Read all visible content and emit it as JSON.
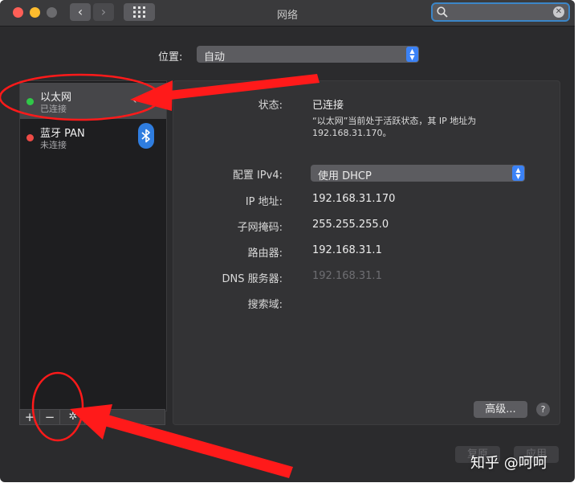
{
  "window": {
    "title": "网络"
  },
  "toolbar": {
    "back_glyph": "‹",
    "forward_glyph": "›"
  },
  "search": {
    "placeholder": ""
  },
  "location": {
    "label": "位置:",
    "value": "自动"
  },
  "services": [
    {
      "name": "以太网",
      "status": "已连接",
      "status_color": "#30c848",
      "icon": "ethernet-icon"
    },
    {
      "name": "蓝牙 PAN",
      "status": "未连接",
      "status_color": "#ee4b46",
      "icon": "bluetooth-icon"
    }
  ],
  "sidebar_toolbar": {
    "add": "+",
    "remove": "−",
    "gear": "✲"
  },
  "detail": {
    "status_label": "状态:",
    "status_value": "已连接",
    "status_desc": "“以太网”当前处于活跃状态，其 IP 地址为 192.168.31.170。",
    "ipv4_label": "配置 IPv4:",
    "ipv4_value": "使用 DHCP",
    "ip_label": "IP 地址:",
    "ip_value": "192.168.31.170",
    "mask_label": "子网掩码:",
    "mask_value": "255.255.255.0",
    "router_label": "路由器:",
    "router_value": "192.168.31.1",
    "dns_label": "DNS 服务器:",
    "dns_value": "192.168.31.1",
    "domain_label": "搜索域:",
    "advanced_label": "高级...",
    "help_label": "?"
  },
  "footer": {
    "revert_label": "复原",
    "apply_label": "应用"
  },
  "watermark": "知乎 @呵呵",
  "colors": {
    "accent": "#3b82f6",
    "annotation": "#ff1a1a"
  }
}
